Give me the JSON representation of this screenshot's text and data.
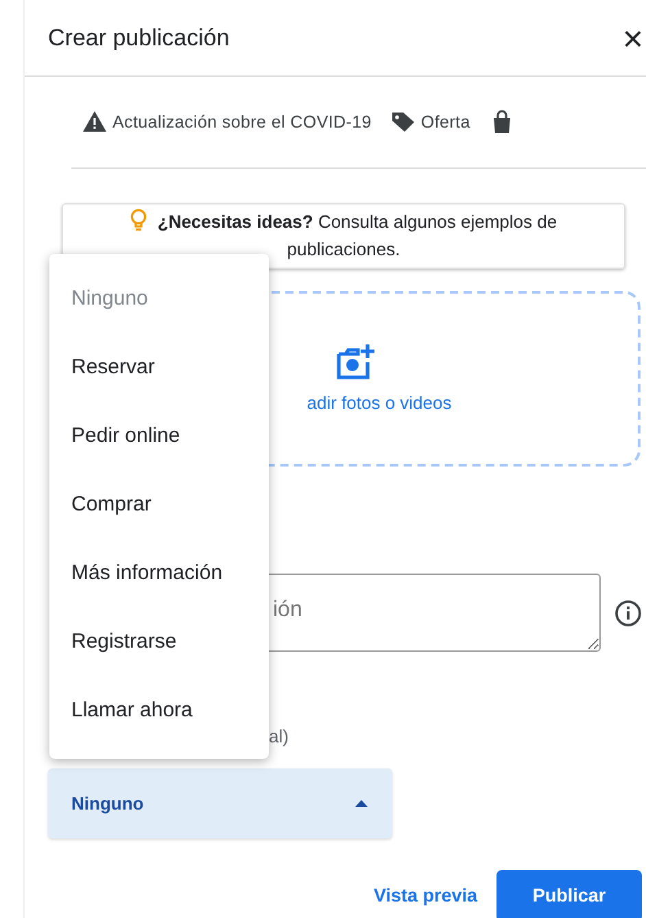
{
  "dialog": {
    "title": "Crear publicación",
    "close": "×"
  },
  "tabs": [
    {
      "label": "Actualización sobre el COVID-19",
      "kind": "warning",
      "selected": false
    },
    {
      "label": "Oferta",
      "kind": "offer",
      "selected": false
    },
    {
      "kind": "product",
      "selected": false
    }
  ],
  "tip": "**¿Necesitas ideas?** Consulta algunos ejemplos de publicaciones.",
  "media": {
    "label": "adir fotos o videos"
  },
  "description": {
    "placeholder": "ión"
  },
  "button_label": "al)",
  "select": {
    "value": "Ninguno",
    "expanded": true
  },
  "menu": [
    {
      "label": "Ninguno",
      "disabled": true
    },
    {
      "label": "Reservar",
      "disabled": false
    },
    {
      "label": "Pedir online",
      "disabled": false
    },
    {
      "label": "Comprar",
      "disabled": false
    },
    {
      "label": "Más información",
      "disabled": false
    },
    {
      "label": "Registrarse",
      "disabled": false
    },
    {
      "label": "Llamar ahora",
      "disabled": false
    }
  ],
  "actions": {
    "preview": "Vista previa",
    "publish": "Publicar"
  }
}
